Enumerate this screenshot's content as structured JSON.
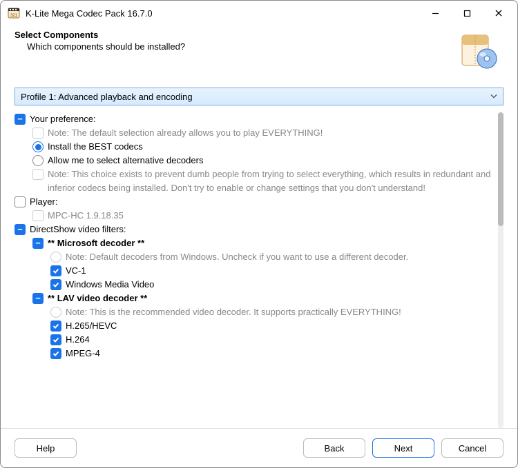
{
  "window": {
    "title": "K-Lite Mega Codec Pack 16.7.0"
  },
  "header": {
    "title": "Select Components",
    "subtitle": "Which components should be installed?"
  },
  "profile": {
    "selected": "Profile 1: Advanced playback and encoding"
  },
  "tree": {
    "pref": {
      "title": "Your preference:",
      "note1": "Note: The default selection already allows you to play EVERYTHING!",
      "opt_best": "Install the BEST codecs",
      "opt_alt": "Allow me to select alternative decoders",
      "note2": "Note: This choice exists to prevent dumb people from trying to select everything, which results in redundant and inferior codecs being installed. Don't try to enable or change settings that you don't understand!"
    },
    "player": {
      "title": "Player:",
      "mpc": "MPC-HC 1.9.18.35"
    },
    "dshow": {
      "title": "DirectShow video filters:",
      "ms": {
        "title": "**  Microsoft decoder  **",
        "note": "Note: Default decoders from Windows. Uncheck if you want to use a different decoder.",
        "vc1": "VC-1",
        "wmv": "Windows Media Video"
      },
      "lav": {
        "title": "**  LAV video decoder  **",
        "note": "Note: This is the recommended video decoder. It supports practically EVERYTHING!",
        "h265": "H.265/HEVC",
        "h264": "H.264",
        "mpeg4": "MPEG-4"
      }
    }
  },
  "buttons": {
    "help": "Help",
    "back": "Back",
    "next": "Next",
    "cancel": "Cancel"
  }
}
